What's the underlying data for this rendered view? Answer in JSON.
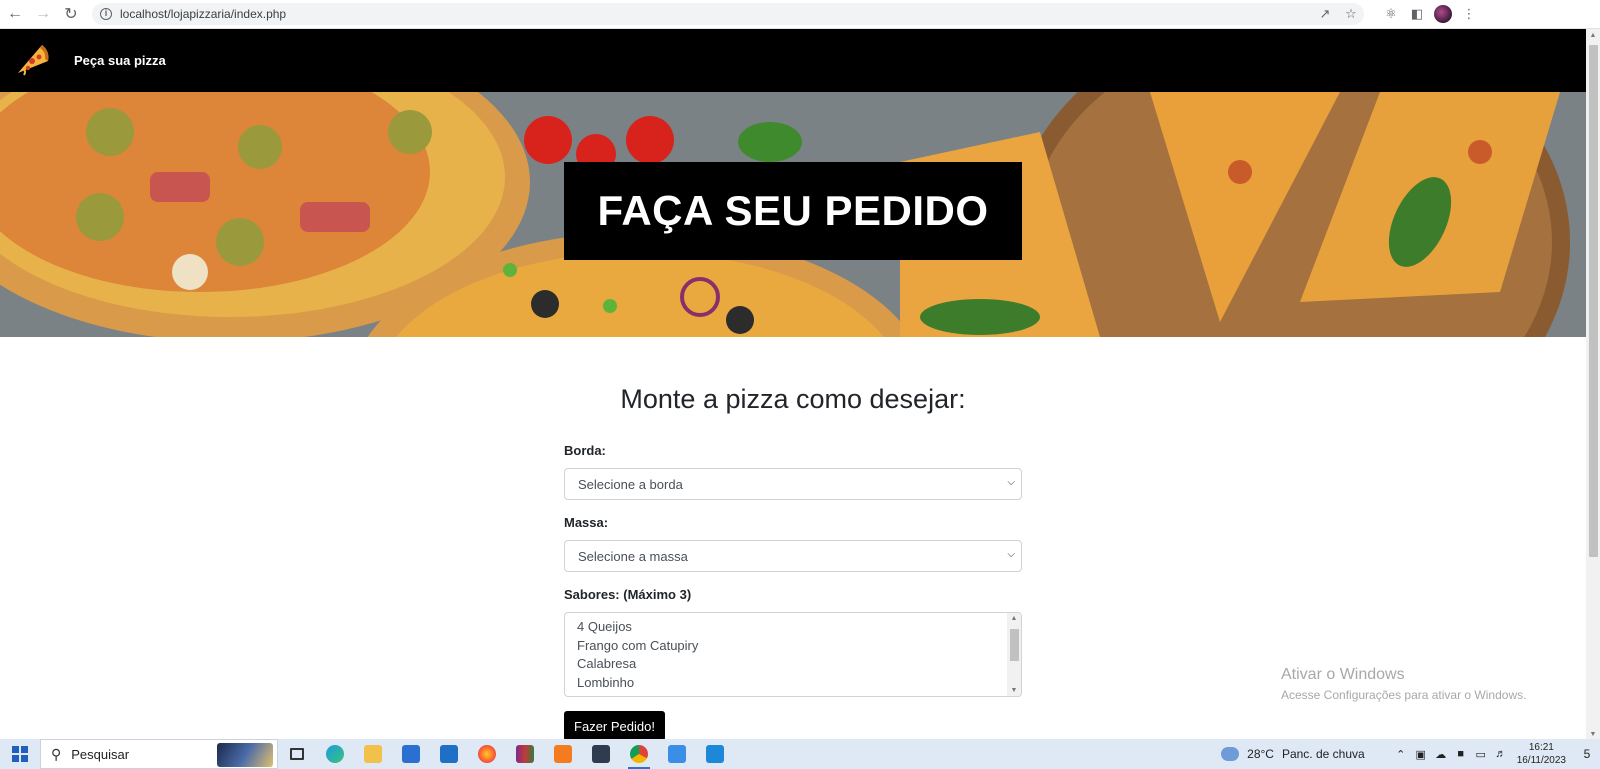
{
  "browser": {
    "url": "localhost/lojapizzaria/index.php"
  },
  "site": {
    "brand": "Peça sua pizza",
    "hero_title": "FAÇA SEU PEDIDO",
    "form_title": "Monte a pizza como desejar:",
    "borda": {
      "label": "Borda:",
      "selected": "Selecione a borda"
    },
    "massa": {
      "label": "Massa:",
      "selected": "Selecione a massa"
    },
    "sabores": {
      "label": "Sabores: (Máximo 3)",
      "options": [
        "4 Queijos",
        "Frango com Catupiry",
        "Calabresa",
        "Lombinho"
      ]
    },
    "submit_label": "Fazer Pedido!"
  },
  "watermark": {
    "line1": "Ativar o Windows",
    "line2": "Acesse Configurações para ativar o Windows."
  },
  "taskbar": {
    "search_placeholder": "Pesquisar",
    "weather_temp": "28°C",
    "weather_text": "Panc. de chuva",
    "time": "16:21",
    "date": "16/11/2023",
    "notification_count": "5"
  },
  "colors": {
    "navbar": "#000000",
    "hero_box": "#000000",
    "button": "#000000",
    "taskbar": "#dfe9f5"
  }
}
